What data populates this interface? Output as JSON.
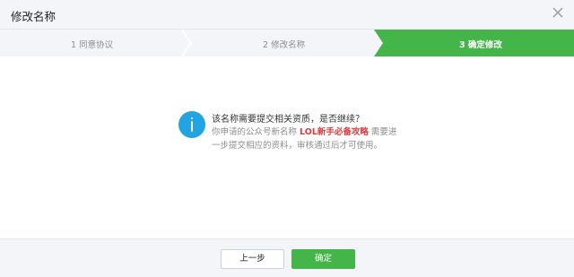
{
  "dialog": {
    "title": "修改名称",
    "close_icon": "close-icon"
  },
  "steps": [
    {
      "label": "1 同意协议",
      "state": "done"
    },
    {
      "label": "2 修改名称",
      "state": "done"
    },
    {
      "label": "3 确定修改",
      "state": "active"
    }
  ],
  "colors": {
    "accent_green": "#44b549",
    "info_blue": "#22a4e3",
    "highlight_red": "#e03b3b"
  },
  "message": {
    "icon": "info-icon",
    "title": "该名称需要提交相关资质，是否继续？",
    "line1_prefix": "你申请的公众号新名称 ",
    "new_name": "LOL新手必备攻略",
    "line1_suffix": " 需要进",
    "line2": "一步提交相应的资料，审核通过后才可使用。"
  },
  "footer": {
    "prev_label": "上一步",
    "confirm_label": "确定"
  }
}
